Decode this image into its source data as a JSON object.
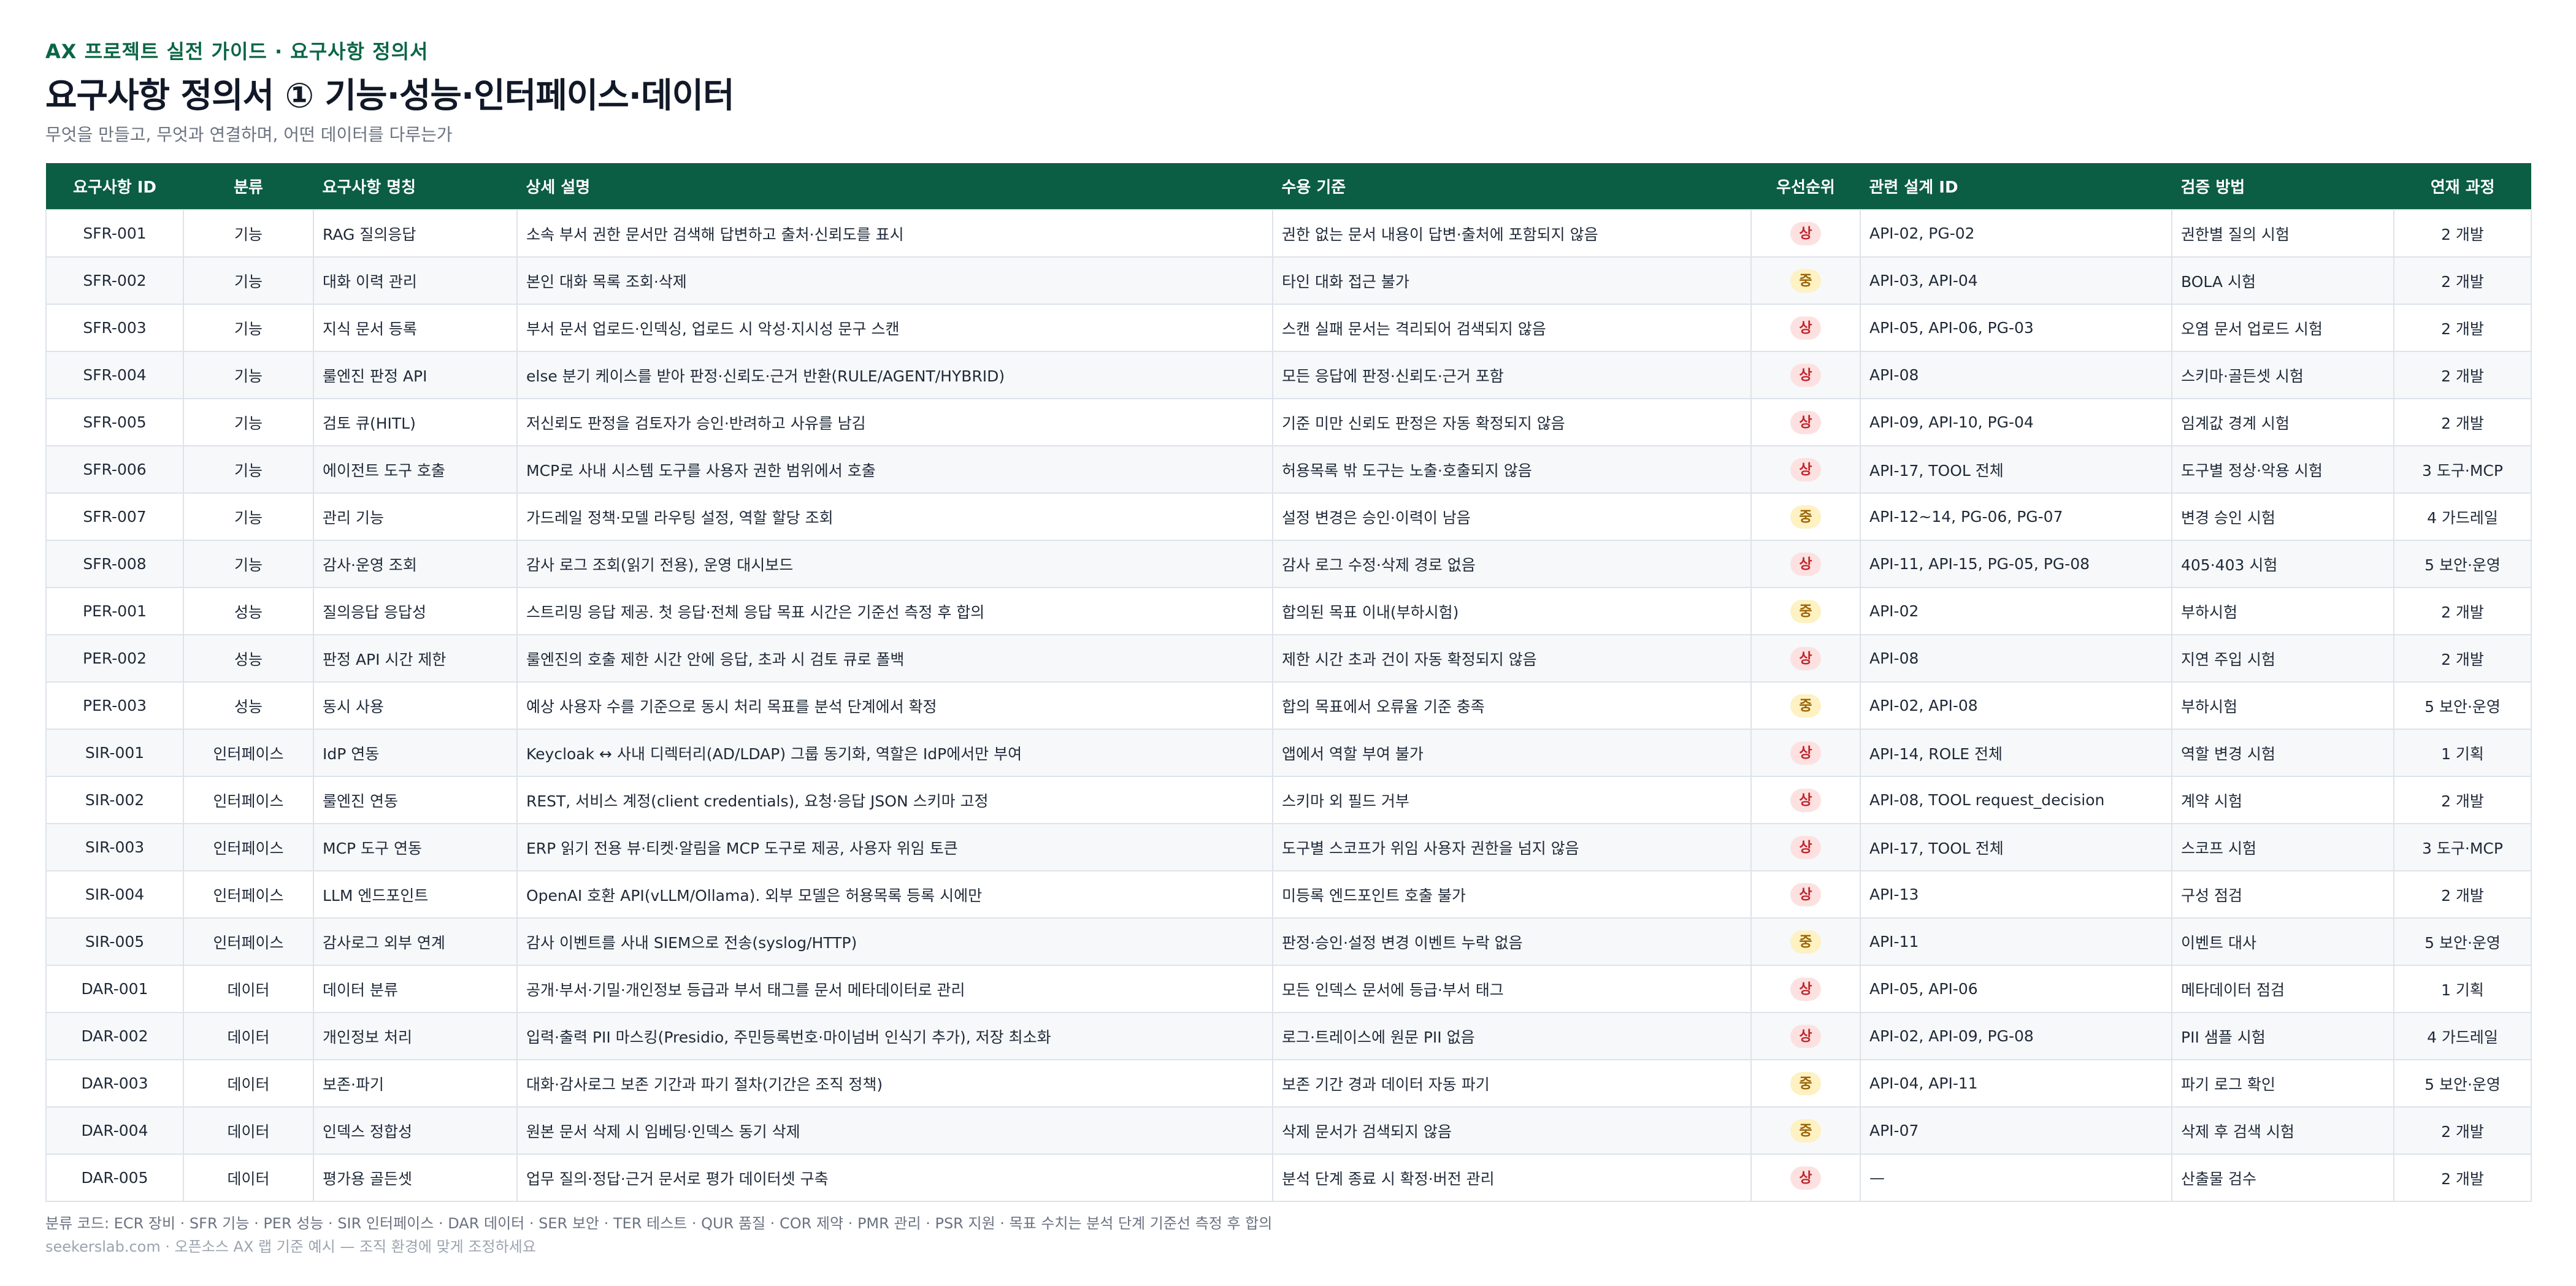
{
  "header": {
    "eyebrow": "AX 프로젝트 실전 가이드 · 요구사항 정의서",
    "title": "요구사항 정의서 ① 기능·성능·인터페이스·데이터",
    "subtitle": "무엇을 만들고, 무엇과 연결하며, 어떤 데이터를 다루는가"
  },
  "table": {
    "columns": [
      "요구사항 ID",
      "분류",
      "요구사항 명칭",
      "상세 설명",
      "수용 기준",
      "우선순위",
      "관련 설계 ID",
      "검증 방법",
      "연재 과정"
    ],
    "rows": [
      {
        "id": "SFR-001",
        "category": "기능",
        "name": "RAG 질의응답",
        "desc": "소속 부서 권한 문서만 검색해 답변하고 출처·신뢰도를 표시",
        "acceptance": "권한 없는 문서 내용이 답변·출처에 포함되지 않음",
        "priority": "상",
        "level": "high",
        "design": "API-02, PG-02",
        "verify": "권한별 질의 시험",
        "series": "2 개발"
      },
      {
        "id": "SFR-002",
        "category": "기능",
        "name": "대화 이력 관리",
        "desc": "본인 대화 목록 조회·삭제",
        "acceptance": "타인 대화 접근 불가",
        "priority": "중",
        "level": "mid",
        "design": "API-03, API-04",
        "verify": "BOLA 시험",
        "series": "2 개발"
      },
      {
        "id": "SFR-003",
        "category": "기능",
        "name": "지식 문서 등록",
        "desc": "부서 문서 업로드·인덱싱, 업로드 시 악성·지시성 문구 스캔",
        "acceptance": "스캔 실패 문서는 격리되어 검색되지 않음",
        "priority": "상",
        "level": "high",
        "design": "API-05, API-06, PG-03",
        "verify": "오염 문서 업로드 시험",
        "series": "2 개발"
      },
      {
        "id": "SFR-004",
        "category": "기능",
        "name": "룰엔진 판정 API",
        "desc": "else 분기 케이스를 받아 판정·신뢰도·근거 반환(RULE/AGENT/HYBRID)",
        "acceptance": "모든 응답에 판정·신뢰도·근거 포함",
        "priority": "상",
        "level": "high",
        "design": "API-08",
        "verify": "스키마·골든셋 시험",
        "series": "2 개발"
      },
      {
        "id": "SFR-005",
        "category": "기능",
        "name": "검토 큐(HITL)",
        "desc": "저신뢰도 판정을 검토자가 승인·반려하고 사유를 남김",
        "acceptance": "기준 미만 신뢰도 판정은 자동 확정되지 않음",
        "priority": "상",
        "level": "high",
        "design": "API-09, API-10, PG-04",
        "verify": "임계값 경계 시험",
        "series": "2 개발"
      },
      {
        "id": "SFR-006",
        "category": "기능",
        "name": "에이전트 도구 호출",
        "desc": "MCP로 사내 시스템 도구를 사용자 권한 범위에서 호출",
        "acceptance": "허용목록 밖 도구는 노출·호출되지 않음",
        "priority": "상",
        "level": "high",
        "design": "API-17, TOOL 전체",
        "verify": "도구별 정상·악용 시험",
        "series": "3 도구·MCP"
      },
      {
        "id": "SFR-007",
        "category": "기능",
        "name": "관리 기능",
        "desc": "가드레일 정책·모델 라우팅 설정, 역할 할당 조회",
        "acceptance": "설정 변경은 승인·이력이 남음",
        "priority": "중",
        "level": "mid",
        "design": "API-12~14, PG-06, PG-07",
        "verify": "변경 승인 시험",
        "series": "4 가드레일"
      },
      {
        "id": "SFR-008",
        "category": "기능",
        "name": "감사·운영 조회",
        "desc": "감사 로그 조회(읽기 전용), 운영 대시보드",
        "acceptance": "감사 로그 수정·삭제 경로 없음",
        "priority": "상",
        "level": "high",
        "design": "API-11, API-15, PG-05, PG-08",
        "verify": "405·403 시험",
        "series": "5 보안·운영"
      },
      {
        "id": "PER-001",
        "category": "성능",
        "name": "질의응답 응답성",
        "desc": "스트리밍 응답 제공. 첫 응답·전체 응답 목표 시간은 기준선 측정 후 합의",
        "acceptance": "합의된 목표 이내(부하시험)",
        "priority": "중",
        "level": "mid",
        "design": "API-02",
        "verify": "부하시험",
        "series": "2 개발"
      },
      {
        "id": "PER-002",
        "category": "성능",
        "name": "판정 API 시간 제한",
        "desc": "룰엔진의 호출 제한 시간 안에 응답, 초과 시 검토 큐로 폴백",
        "acceptance": "제한 시간 초과 건이 자동 확정되지 않음",
        "priority": "상",
        "level": "high",
        "design": "API-08",
        "verify": "지연 주입 시험",
        "series": "2 개발"
      },
      {
        "id": "PER-003",
        "category": "성능",
        "name": "동시 사용",
        "desc": "예상 사용자 수를 기준으로 동시 처리 목표를 분석 단계에서 확정",
        "acceptance": "합의 목표에서 오류율 기준 충족",
        "priority": "중",
        "level": "mid",
        "design": "API-02, API-08",
        "verify": "부하시험",
        "series": "5 보안·운영"
      },
      {
        "id": "SIR-001",
        "category": "인터페이스",
        "name": "IdP 연동",
        "desc": "Keycloak ↔ 사내 디렉터리(AD/LDAP) 그룹 동기화, 역할은 IdP에서만 부여",
        "acceptance": "앱에서 역할 부여 불가",
        "priority": "상",
        "level": "high",
        "design": "API-14, ROLE 전체",
        "verify": "역할 변경 시험",
        "series": "1 기획"
      },
      {
        "id": "SIR-002",
        "category": "인터페이스",
        "name": "룰엔진 연동",
        "desc": "REST, 서비스 계정(client credentials), 요청·응답 JSON 스키마 고정",
        "acceptance": "스키마 외 필드 거부",
        "priority": "상",
        "level": "high",
        "design": "API-08, TOOL request_decision",
        "verify": "계약 시험",
        "series": "2 개발"
      },
      {
        "id": "SIR-003",
        "category": "인터페이스",
        "name": "MCP 도구 연동",
        "desc": "ERP 읽기 전용 뷰·티켓·알림을 MCP 도구로 제공, 사용자 위임 토큰",
        "acceptance": "도구별 스코프가 위임 사용자 권한을 넘지 않음",
        "priority": "상",
        "level": "high",
        "design": "API-17, TOOL 전체",
        "verify": "스코프 시험",
        "series": "3 도구·MCP"
      },
      {
        "id": "SIR-004",
        "category": "인터페이스",
        "name": "LLM 엔드포인트",
        "desc": "OpenAI 호환 API(vLLM/Ollama). 외부 모델은 허용목록 등록 시에만",
        "acceptance": "미등록 엔드포인트 호출 불가",
        "priority": "상",
        "level": "high",
        "design": "API-13",
        "verify": "구성 점검",
        "series": "2 개발"
      },
      {
        "id": "SIR-005",
        "category": "인터페이스",
        "name": "감사로그 외부 연계",
        "desc": "감사 이벤트를 사내 SIEM으로 전송(syslog/HTTP)",
        "acceptance": "판정·승인·설정 변경 이벤트 누락 없음",
        "priority": "중",
        "level": "mid",
        "design": "API-11",
        "verify": "이벤트 대사",
        "series": "5 보안·운영"
      },
      {
        "id": "DAR-001",
        "category": "데이터",
        "name": "데이터 분류",
        "desc": "공개·부서·기밀·개인정보 등급과 부서 태그를 문서 메타데이터로 관리",
        "acceptance": "모든 인덱스 문서에 등급·부서 태그",
        "priority": "상",
        "level": "high",
        "design": "API-05, API-06",
        "verify": "메타데이터 점검",
        "series": "1 기획"
      },
      {
        "id": "DAR-002",
        "category": "데이터",
        "name": "개인정보 처리",
        "desc": "입력·출력 PII 마스킹(Presidio, 주민등록번호·마이넘버 인식기 추가), 저장 최소화",
        "acceptance": "로그·트레이스에 원문 PII 없음",
        "priority": "상",
        "level": "high",
        "design": "API-02, API-09, PG-08",
        "verify": "PII 샘플 시험",
        "series": "4 가드레일"
      },
      {
        "id": "DAR-003",
        "category": "데이터",
        "name": "보존·파기",
        "desc": "대화·감사로그 보존 기간과 파기 절차(기간은 조직 정책)",
        "acceptance": "보존 기간 경과 데이터 자동 파기",
        "priority": "중",
        "level": "mid",
        "design": "API-04, API-11",
        "verify": "파기 로그 확인",
        "series": "5 보안·운영"
      },
      {
        "id": "DAR-004",
        "category": "데이터",
        "name": "인덱스 정합성",
        "desc": "원본 문서 삭제 시 임베딩·인덱스 동기 삭제",
        "acceptance": "삭제 문서가 검색되지 않음",
        "priority": "중",
        "level": "mid",
        "design": "API-07",
        "verify": "삭제 후 검색 시험",
        "series": "2 개발"
      },
      {
        "id": "DAR-005",
        "category": "데이터",
        "name": "평가용 골든셋",
        "desc": "업무 질의·정답·근거 문서로 평가 데이터셋 구축",
        "acceptance": "분석 단계 종료 시 확정·버전 관리",
        "priority": "상",
        "level": "high",
        "design": "—",
        "verify": "산출물 검수",
        "series": "2 개발"
      }
    ]
  },
  "footer": {
    "note": "분류 코드: ECR 장비 · SFR 기능 · PER 성능 · SIR 인터페이스 · DAR 데이터 · SER 보안 · TER 테스트 · QUR 품질 · COR 제약 · PMR 관리 · PSR 지원 · 목표 수치는 분석 단계 기준선 측정 후 합의",
    "credit": "seekerslab.com · 오픈소스 AX 랩 기준 예시 — 조직 환경에 맞게 조정하세요"
  },
  "colors": {
    "accent": "#0b5d43",
    "priority_high_bg": "#fde1e1",
    "priority_high_text": "#c0262b",
    "priority_mid_bg": "#fef1c2",
    "priority_mid_text": "#9a6308"
  }
}
